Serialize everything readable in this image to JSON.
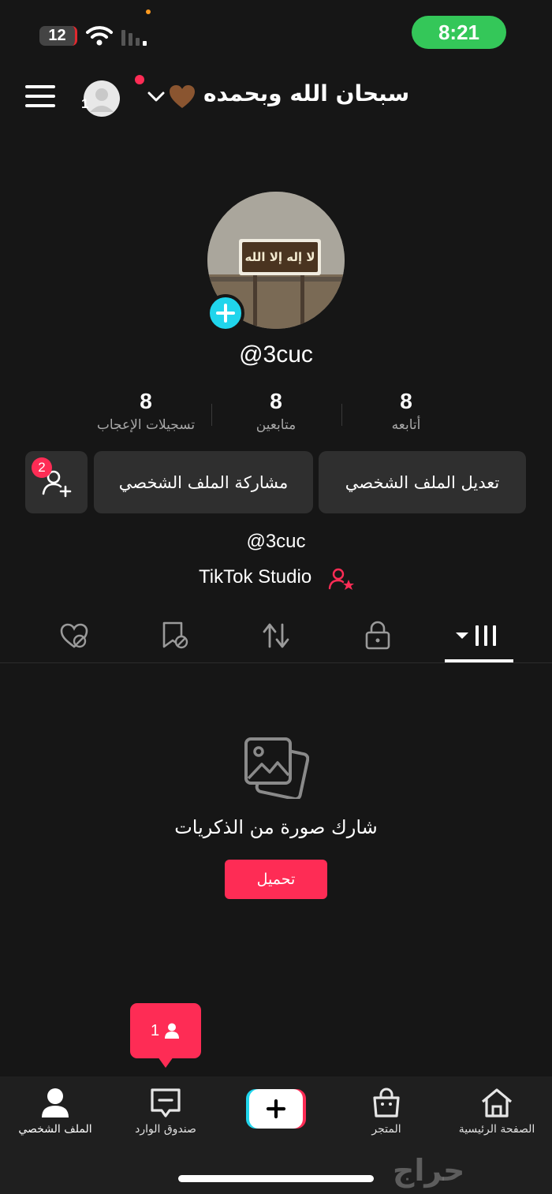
{
  "status_bar": {
    "time": "8:21",
    "battery": "12"
  },
  "header": {
    "title": "سبحان الله وبحمده",
    "avatar_count": "1"
  },
  "profile": {
    "handle": "@3cuc",
    "sign_text": "لا إله إلا الله",
    "stats": [
      {
        "value": "8",
        "label": "أتابعه"
      },
      {
        "value": "8",
        "label": "متابعين"
      },
      {
        "value": "8",
        "label": "تسجيلات الإعجاب"
      }
    ],
    "edit_label": "تعديل الملف الشخصي",
    "share_label": "مشاركة الملف الشخصي",
    "friend_badge": "2",
    "bio_handle": "@3cuc",
    "studio_label": "TikTok Studio"
  },
  "tabs": [
    {
      "icon": "grid-icon",
      "active": true
    },
    {
      "icon": "lock-icon"
    },
    {
      "icon": "repost-icon"
    },
    {
      "icon": "favorites-icon"
    },
    {
      "icon": "liked-hidden-icon"
    }
  ],
  "empty_state": {
    "text": "شارك صورة من الذكريات",
    "button": "تحميل"
  },
  "inbox_tooltip": {
    "count": "1"
  },
  "nav": {
    "home": "الصفحة الرئيسية",
    "shop": "المتجر",
    "inbox": "صندوق الوارد",
    "profile": "الملف الشخصي"
  },
  "watermark": "حراج",
  "colors": {
    "accent": "#fe2c55",
    "cyan": "#20d5ec",
    "background": "#161616",
    "status_green": "#34c759"
  }
}
